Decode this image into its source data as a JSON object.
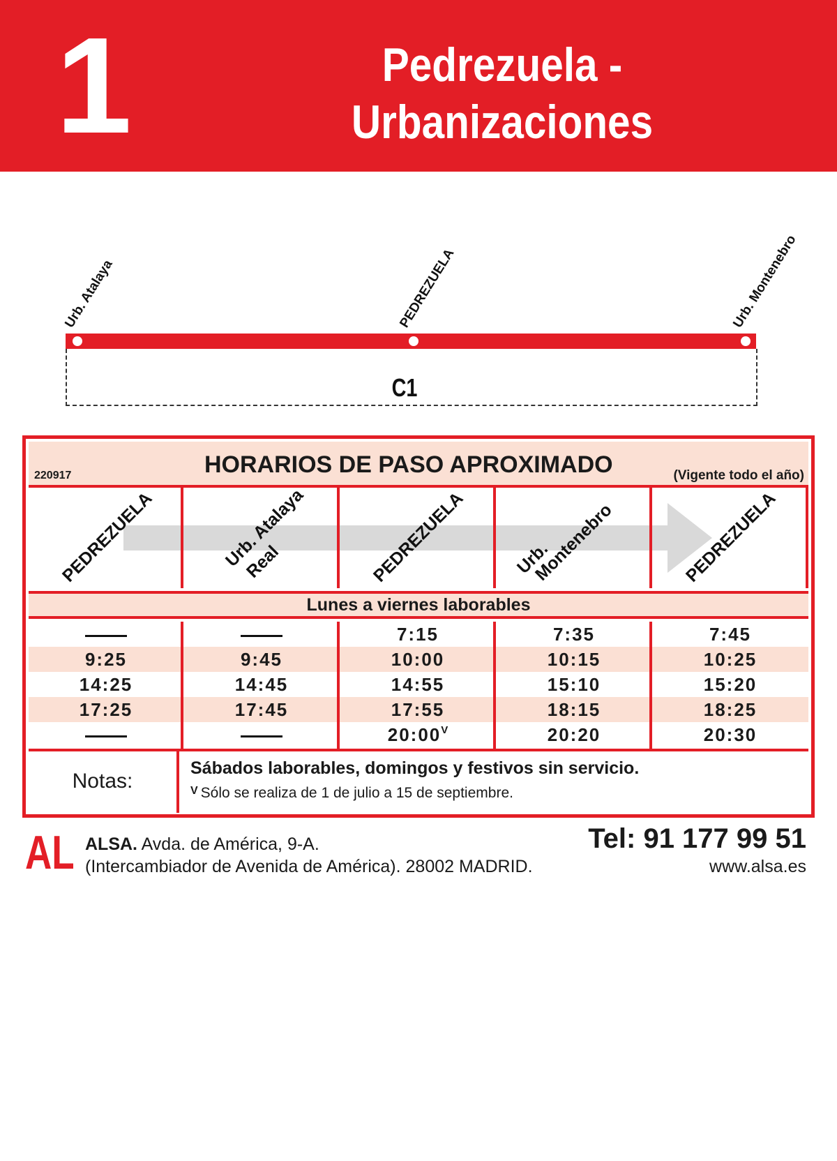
{
  "header": {
    "line_number": "1",
    "title_line1": "Pedrezuela -",
    "title_line2": "Urbanizaciones"
  },
  "route": {
    "stops": [
      "Urb. Atalaya",
      "PEDREZUELA",
      "Urb. Montenebro"
    ],
    "circuit_code": "C1"
  },
  "timetable": {
    "code": "220917",
    "title": "HORARIOS DE PASO APROXIMADO",
    "validity": "(Vigente todo el año)",
    "columns": [
      {
        "line1": "PEDREZUELA",
        "line2": ""
      },
      {
        "line1": "Urb. Atalaya",
        "line2": "Real"
      },
      {
        "line1": "PEDREZUELA",
        "line2": ""
      },
      {
        "line1": "Urb.",
        "line2": "Montenebro"
      },
      {
        "line1": "PEDREZUELA",
        "line2": ""
      }
    ],
    "day_type": "Lunes a viernes laborables",
    "rows": [
      [
        "—",
        "—",
        "7:15",
        "7:35",
        "7:45"
      ],
      [
        "9:25",
        "9:45",
        "10:00",
        "10:15",
        "10:25"
      ],
      [
        "14:25",
        "14:45",
        "14:55",
        "15:10",
        "15:20"
      ],
      [
        "17:25",
        "17:45",
        "17:55",
        "18:15",
        "18:25"
      ],
      [
        "—",
        "—",
        "20:00",
        "20:20",
        "20:30"
      ]
    ],
    "note_marker": "V",
    "notes_label": "Notas:",
    "notes_main": "Sábados laborables, domingos y festivos sin servicio.",
    "notes_sub": "Sólo se realiza de 1 de julio a 15 de septiembre."
  },
  "footer": {
    "logo": "AL",
    "company_name": "ALSA.",
    "company_address": "Avda. de América, 9-A.",
    "company_address2": "(Intercambiador de Avenida de América). 28002 MADRID.",
    "phone": "Tel: 91 177 99 51",
    "website": "www.alsa.es"
  },
  "colors": {
    "brand_red": "#e31e26",
    "shade": "#fbe0d4",
    "arrow_gray": "#d9d9d9"
  }
}
